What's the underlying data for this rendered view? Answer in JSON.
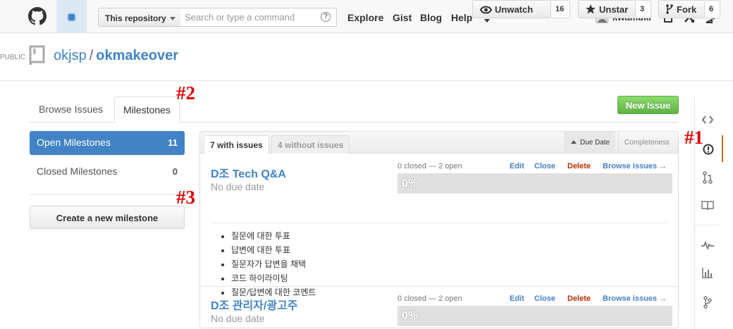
{
  "header": {
    "scope_label": "This repository",
    "search_placeholder": "Search or type a command",
    "help_glyph": "?",
    "nav": [
      "Explore",
      "Gist",
      "Blog",
      "Help"
    ],
    "username": "kwamuki"
  },
  "repo": {
    "visibility": "PUBLIC",
    "owner": "okjsp",
    "separator": "/",
    "name": "okmakeover",
    "watch_label": "Unwatch",
    "watch_count": "16",
    "star_label": "Unstar",
    "star_count": "3",
    "fork_label": "Fork",
    "fork_count": "6"
  },
  "tabs": {
    "browse": "Browse Issues",
    "milestones": "Milestones"
  },
  "new_issue_label": "New Issue",
  "annotations": {
    "a1": "#1",
    "a2": "#2",
    "a3": "#3"
  },
  "sidebar": {
    "open_label": "Open Milestones",
    "open_count": "11",
    "closed_label": "Closed Milestones",
    "closed_count": "0",
    "create_label": "Create a new milestone"
  },
  "filters": {
    "with_issues": "7 with issues",
    "without_issues": "4 without issues",
    "sort_due": "Due Date",
    "sort_completeness": "Completeness"
  },
  "milestones": [
    {
      "title": "D조 Tech Q&A",
      "due": "No due date",
      "stats": "0 closed — 2 open",
      "progress_percent": 0,
      "progress_label": "0%",
      "edit": "Edit",
      "close": "Close",
      "delete": "Delete",
      "browse": "Browse issues →",
      "description": [
        "질문에 대한 투표",
        "답변에 대한 투표",
        "질문자가 답변을 채택",
        "코드 하이라이팅",
        "질문/답변에 대한 코멘트"
      ]
    },
    {
      "title": "D조 관리자/광고주",
      "due": "No due date",
      "stats": "0 closed — 2 open",
      "progress_percent": 0,
      "progress_label": "0%",
      "edit": "Edit",
      "close": "Close",
      "delete": "Delete",
      "browse": "Browse issues →"
    }
  ],
  "colors": {
    "link": "#4183c4",
    "active_sidebar": "#4183c4",
    "new_issue": "#6cc644",
    "delete": "#bd2c00",
    "annotation": "#dd0000",
    "active_nav_marker": "#d26911"
  }
}
